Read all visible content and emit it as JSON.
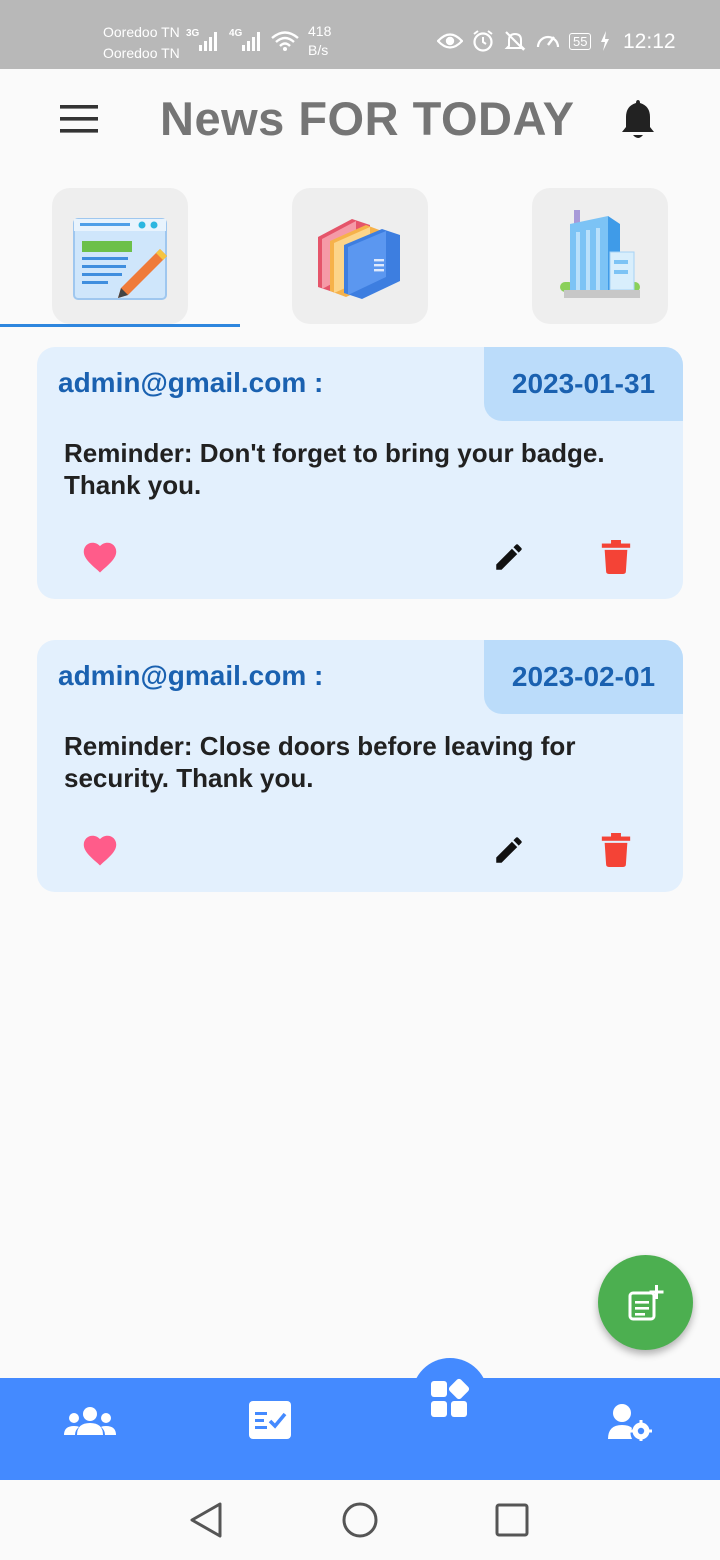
{
  "status_bar": {
    "carrier_1": "Ooredoo TN",
    "carrier_2": "Ooredoo TN",
    "network_1": "3G",
    "network_2": "4G",
    "speed_value": "418",
    "speed_unit": "B/s",
    "battery": "55",
    "time": "12:12"
  },
  "app_bar": {
    "title": "News FOR TODAY",
    "menu_icon": "hamburger-menu-icon",
    "notification_icon": "bell-icon"
  },
  "tabs": {
    "selected_index": 0,
    "items": [
      {
        "icon": "news-edit-icon"
      },
      {
        "icon": "folders-icon"
      },
      {
        "icon": "building-icon"
      }
    ]
  },
  "posts": [
    {
      "author": "admin@gmail.com :",
      "date": "2023-01-31",
      "message": "Reminder: Don't forget to bring your badge. Thank you."
    },
    {
      "author": "admin@gmail.com :",
      "date": "2023-02-01",
      "message": "Reminder: Close doors before leaving for security. Thank you."
    }
  ],
  "colors": {
    "accent": "#448aff",
    "card_bg": "#e3f0fd",
    "date_bg": "#bbdcfa",
    "author_text": "#1a61b0",
    "like": "#ff5c8a",
    "delete": "#f44336",
    "fab": "#4caf50"
  },
  "fab": {
    "icon": "add-post-icon"
  },
  "bottom_nav": {
    "items": [
      {
        "icon": "users-icon"
      },
      {
        "icon": "tasks-icon"
      },
      {
        "icon": "dashboard-icon"
      },
      {
        "icon": "user-settings-icon"
      }
    ],
    "selected_index": 2
  },
  "system_nav": {
    "items": [
      "back-icon",
      "home-icon",
      "recents-icon"
    ]
  }
}
